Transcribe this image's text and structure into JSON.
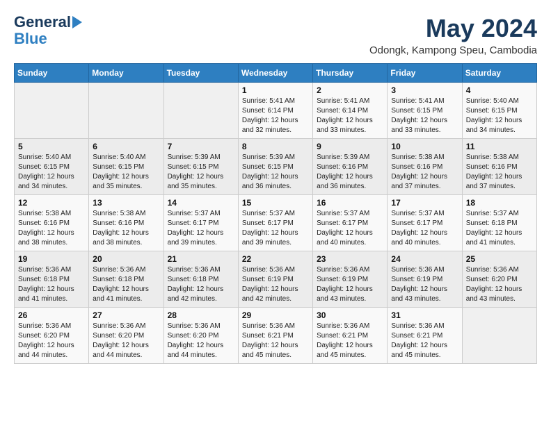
{
  "header": {
    "logo_general": "General",
    "logo_blue": "Blue",
    "month": "May 2024",
    "location": "Odongk, Kampong Speu, Cambodia"
  },
  "weekdays": [
    "Sunday",
    "Monday",
    "Tuesday",
    "Wednesday",
    "Thursday",
    "Friday",
    "Saturday"
  ],
  "weeks": [
    [
      {
        "day": "",
        "info": ""
      },
      {
        "day": "",
        "info": ""
      },
      {
        "day": "",
        "info": ""
      },
      {
        "day": "1",
        "info": "Sunrise: 5:41 AM\nSunset: 6:14 PM\nDaylight: 12 hours\nand 32 minutes."
      },
      {
        "day": "2",
        "info": "Sunrise: 5:41 AM\nSunset: 6:14 PM\nDaylight: 12 hours\nand 33 minutes."
      },
      {
        "day": "3",
        "info": "Sunrise: 5:41 AM\nSunset: 6:15 PM\nDaylight: 12 hours\nand 33 minutes."
      },
      {
        "day": "4",
        "info": "Sunrise: 5:40 AM\nSunset: 6:15 PM\nDaylight: 12 hours\nand 34 minutes."
      }
    ],
    [
      {
        "day": "5",
        "info": "Sunrise: 5:40 AM\nSunset: 6:15 PM\nDaylight: 12 hours\nand 34 minutes."
      },
      {
        "day": "6",
        "info": "Sunrise: 5:40 AM\nSunset: 6:15 PM\nDaylight: 12 hours\nand 35 minutes."
      },
      {
        "day": "7",
        "info": "Sunrise: 5:39 AM\nSunset: 6:15 PM\nDaylight: 12 hours\nand 35 minutes."
      },
      {
        "day": "8",
        "info": "Sunrise: 5:39 AM\nSunset: 6:15 PM\nDaylight: 12 hours\nand 36 minutes."
      },
      {
        "day": "9",
        "info": "Sunrise: 5:39 AM\nSunset: 6:16 PM\nDaylight: 12 hours\nand 36 minutes."
      },
      {
        "day": "10",
        "info": "Sunrise: 5:38 AM\nSunset: 6:16 PM\nDaylight: 12 hours\nand 37 minutes."
      },
      {
        "day": "11",
        "info": "Sunrise: 5:38 AM\nSunset: 6:16 PM\nDaylight: 12 hours\nand 37 minutes."
      }
    ],
    [
      {
        "day": "12",
        "info": "Sunrise: 5:38 AM\nSunset: 6:16 PM\nDaylight: 12 hours\nand 38 minutes."
      },
      {
        "day": "13",
        "info": "Sunrise: 5:38 AM\nSunset: 6:16 PM\nDaylight: 12 hours\nand 38 minutes."
      },
      {
        "day": "14",
        "info": "Sunrise: 5:37 AM\nSunset: 6:17 PM\nDaylight: 12 hours\nand 39 minutes."
      },
      {
        "day": "15",
        "info": "Sunrise: 5:37 AM\nSunset: 6:17 PM\nDaylight: 12 hours\nand 39 minutes."
      },
      {
        "day": "16",
        "info": "Sunrise: 5:37 AM\nSunset: 6:17 PM\nDaylight: 12 hours\nand 40 minutes."
      },
      {
        "day": "17",
        "info": "Sunrise: 5:37 AM\nSunset: 6:17 PM\nDaylight: 12 hours\nand 40 minutes."
      },
      {
        "day": "18",
        "info": "Sunrise: 5:37 AM\nSunset: 6:18 PM\nDaylight: 12 hours\nand 41 minutes."
      }
    ],
    [
      {
        "day": "19",
        "info": "Sunrise: 5:36 AM\nSunset: 6:18 PM\nDaylight: 12 hours\nand 41 minutes."
      },
      {
        "day": "20",
        "info": "Sunrise: 5:36 AM\nSunset: 6:18 PM\nDaylight: 12 hours\nand 41 minutes."
      },
      {
        "day": "21",
        "info": "Sunrise: 5:36 AM\nSunset: 6:18 PM\nDaylight: 12 hours\nand 42 minutes."
      },
      {
        "day": "22",
        "info": "Sunrise: 5:36 AM\nSunset: 6:19 PM\nDaylight: 12 hours\nand 42 minutes."
      },
      {
        "day": "23",
        "info": "Sunrise: 5:36 AM\nSunset: 6:19 PM\nDaylight: 12 hours\nand 43 minutes."
      },
      {
        "day": "24",
        "info": "Sunrise: 5:36 AM\nSunset: 6:19 PM\nDaylight: 12 hours\nand 43 minutes."
      },
      {
        "day": "25",
        "info": "Sunrise: 5:36 AM\nSunset: 6:20 PM\nDaylight: 12 hours\nand 43 minutes."
      }
    ],
    [
      {
        "day": "26",
        "info": "Sunrise: 5:36 AM\nSunset: 6:20 PM\nDaylight: 12 hours\nand 44 minutes."
      },
      {
        "day": "27",
        "info": "Sunrise: 5:36 AM\nSunset: 6:20 PM\nDaylight: 12 hours\nand 44 minutes."
      },
      {
        "day": "28",
        "info": "Sunrise: 5:36 AM\nSunset: 6:20 PM\nDaylight: 12 hours\nand 44 minutes."
      },
      {
        "day": "29",
        "info": "Sunrise: 5:36 AM\nSunset: 6:21 PM\nDaylight: 12 hours\nand 45 minutes."
      },
      {
        "day": "30",
        "info": "Sunrise: 5:36 AM\nSunset: 6:21 PM\nDaylight: 12 hours\nand 45 minutes."
      },
      {
        "day": "31",
        "info": "Sunrise: 5:36 AM\nSunset: 6:21 PM\nDaylight: 12 hours\nand 45 minutes."
      },
      {
        "day": "",
        "info": ""
      }
    ]
  ]
}
